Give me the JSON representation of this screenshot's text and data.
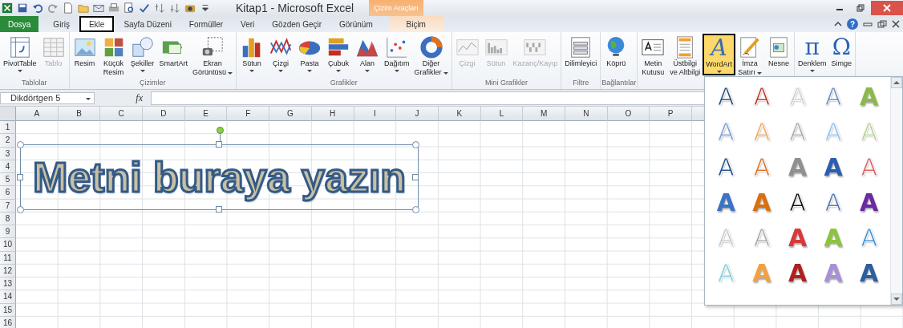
{
  "window": {
    "title": "Kitap1  -  Microsoft Excel",
    "contextual_tab": "Çizim Araçları"
  },
  "tabs": [
    {
      "label": "Dosya",
      "kind": "file",
      "selected": false
    },
    {
      "label": "Giriş",
      "kind": "normal",
      "selected": false
    },
    {
      "label": "Ekle",
      "kind": "normal",
      "selected": true
    },
    {
      "label": "Sayfa Düzeni",
      "kind": "normal",
      "selected": false
    },
    {
      "label": "Formüller",
      "kind": "normal",
      "selected": false
    },
    {
      "label": "Veri",
      "kind": "normal",
      "selected": false
    },
    {
      "label": "Gözden Geçir",
      "kind": "normal",
      "selected": false
    },
    {
      "label": "Görünüm",
      "kind": "normal",
      "selected": false
    },
    {
      "label": "Biçim",
      "kind": "contextual",
      "selected": false
    }
  ],
  "help": "?",
  "ribbon": [
    {
      "label": "Tablolar",
      "buttons": [
        {
          "label": "PivotTable",
          "kind": "pivot-table",
          "dropdown": true,
          "disabled": false,
          "selected": false
        },
        {
          "label": "Tablo",
          "kind": "table",
          "dropdown": false,
          "disabled": true,
          "selected": false
        }
      ]
    },
    {
      "label": "Çizimler",
      "buttons": [
        {
          "label": "Resim",
          "kind": "picture",
          "dropdown": false,
          "disabled": false,
          "selected": false
        },
        {
          "label": "Küçük\nResim",
          "kind": "clip-art",
          "dropdown": false,
          "disabled": false,
          "selected": false
        },
        {
          "label": "Şekiller",
          "kind": "shapes",
          "dropdown": true,
          "disabled": false,
          "selected": false
        },
        {
          "label": "SmartArt",
          "kind": "smartart",
          "dropdown": false,
          "disabled": false,
          "selected": false
        },
        {
          "label": "Ekran\nGörüntüsü",
          "kind": "screenshot",
          "dropdown": true,
          "disabled": false,
          "selected": false
        }
      ]
    },
    {
      "label": "Grafikler",
      "buttons": [
        {
          "label": "Sütun",
          "kind": "column-chart",
          "dropdown": true,
          "disabled": false,
          "selected": false
        },
        {
          "label": "Çizgi",
          "kind": "line-chart",
          "dropdown": true,
          "disabled": false,
          "selected": false
        },
        {
          "label": "Pasta",
          "kind": "pie-chart",
          "dropdown": true,
          "disabled": false,
          "selected": false
        },
        {
          "label": "Çubuk",
          "kind": "bar-chart",
          "dropdown": true,
          "disabled": false,
          "selected": false
        },
        {
          "label": "Alan",
          "kind": "area-chart",
          "dropdown": true,
          "disabled": false,
          "selected": false
        },
        {
          "label": "Dağıtım",
          "kind": "scatter-chart",
          "dropdown": true,
          "disabled": false,
          "selected": false
        },
        {
          "label": "Diğer\nGrafikler",
          "kind": "donut-chart",
          "dropdown": true,
          "disabled": false,
          "selected": false
        }
      ]
    },
    {
      "label": "Mini Grafikler",
      "buttons": [
        {
          "label": "Çizgi",
          "kind": "sparkline-line",
          "dropdown": false,
          "disabled": true,
          "selected": false
        },
        {
          "label": "Sütun",
          "kind": "sparkline-column",
          "dropdown": false,
          "disabled": true,
          "selected": false
        },
        {
          "label": "Kazanç/Kayıp",
          "kind": "sparkline-winloss",
          "dropdown": false,
          "disabled": true,
          "selected": false
        }
      ]
    },
    {
      "label": "Filtre",
      "buttons": [
        {
          "label": "Dilimleyici",
          "kind": "slicer",
          "dropdown": false,
          "disabled": false,
          "selected": false
        }
      ]
    },
    {
      "label": "Bağlantılar",
      "buttons": [
        {
          "label": "Köprü",
          "kind": "globe",
          "dropdown": false,
          "disabled": false,
          "selected": false
        }
      ]
    },
    {
      "buttons": [
        {
          "label": "Metin\nKutusu",
          "kind": "text-box",
          "dropdown": false,
          "disabled": false,
          "selected": false
        },
        {
          "label": "Üstbilgi\nve Altbilgi",
          "kind": "header-footer",
          "dropdown": false,
          "disabled": false,
          "selected": false
        },
        {
          "label": "WordArt",
          "kind": "wordart",
          "glyph": "A",
          "dropdown": true,
          "disabled": false,
          "selected": true
        },
        {
          "label": "İmza\nSatırı",
          "kind": "signature",
          "dropdown": true,
          "disabled": false,
          "selected": false
        },
        {
          "label": "Nesne",
          "kind": "object",
          "dropdown": false,
          "disabled": false,
          "selected": false
        }
      ]
    },
    {
      "buttons": [
        {
          "label": "Denklem",
          "kind": "equation",
          "glyph": "π",
          "dropdown": true,
          "disabled": false,
          "selected": false
        },
        {
          "label": "Simge",
          "kind": "symbol",
          "glyph": "Ω",
          "dropdown": false,
          "disabled": false,
          "selected": false
        }
      ]
    }
  ],
  "formula_bar": {
    "name_box": "Dikdörtgen 5",
    "fx": "fx"
  },
  "sheet": {
    "columns": [
      "A",
      "B",
      "C",
      "D",
      "E",
      "F",
      "G",
      "H",
      "I",
      "J",
      "K",
      "L",
      "M",
      "N",
      "O",
      "P"
    ],
    "rows": [
      "1",
      "2",
      "3",
      "4",
      "5",
      "6",
      "7",
      "8",
      "9",
      "10",
      "11",
      "12",
      "13",
      "14",
      "15",
      "16"
    ]
  },
  "shape": {
    "text": "Metni buraya yazın",
    "selected": true
  },
  "wordart_gallery": [
    {
      "label": "A",
      "kind": "outline",
      "color": "#2c4f7c"
    },
    {
      "label": "A",
      "kind": "outline",
      "color": "#c0392b"
    },
    {
      "label": "A",
      "kind": "outline",
      "color": "#cfcfcf"
    },
    {
      "label": "A",
      "kind": "outline",
      "color": "#6a8fc0"
    },
    {
      "label": "A",
      "kind": "solid",
      "color": "#8db849"
    },
    {
      "label": "A",
      "kind": "outline",
      "color": "#7b9fd6"
    },
    {
      "label": "A",
      "kind": "outline",
      "color": "#f0a860"
    },
    {
      "label": "A",
      "kind": "outline",
      "color": "#aaaaaa"
    },
    {
      "label": "A",
      "kind": "outline",
      "color": "#8ec1ee"
    },
    {
      "label": "A",
      "kind": "outline",
      "color": "#b5d48c"
    },
    {
      "label": "A",
      "kind": "outline",
      "color": "#1f4e8c"
    },
    {
      "label": "A",
      "kind": "outline",
      "color": "#e07020"
    },
    {
      "label": "A",
      "kind": "solid",
      "color": "#909090"
    },
    {
      "label": "A",
      "kind": "solid",
      "color": "#2a5faf"
    },
    {
      "label": "A",
      "kind": "outline",
      "color": "#d96060"
    },
    {
      "label": "A",
      "kind": "solid",
      "color": "#3a74c4"
    },
    {
      "label": "A",
      "kind": "solid",
      "color": "#d9700f"
    },
    {
      "label": "A",
      "kind": "outline",
      "color": "#111111"
    },
    {
      "label": "A",
      "kind": "outline",
      "color": "#4a78b5"
    },
    {
      "label": "A",
      "kind": "solid",
      "color": "#6a2aa0"
    },
    {
      "label": "A",
      "kind": "outline",
      "color": "#c8c8c8"
    },
    {
      "label": "A",
      "kind": "outline",
      "color": "#a8a8a8"
    },
    {
      "label": "A",
      "kind": "solid",
      "color": "#d83a3a"
    },
    {
      "label": "A",
      "kind": "solid",
      "color": "#8cc43e"
    },
    {
      "label": "A",
      "kind": "outline",
      "color": "#3a8fd8"
    },
    {
      "label": "A",
      "kind": "outline",
      "color": "#7fcfe0"
    },
    {
      "label": "A",
      "kind": "solid",
      "color": "#f3a040"
    },
    {
      "label": "A",
      "kind": "solid",
      "color": "#b02020"
    },
    {
      "label": "A",
      "kind": "solid",
      "color": "#a890d8"
    },
    {
      "label": "A",
      "kind": "solid",
      "color": "#2c5d9e"
    }
  ]
}
